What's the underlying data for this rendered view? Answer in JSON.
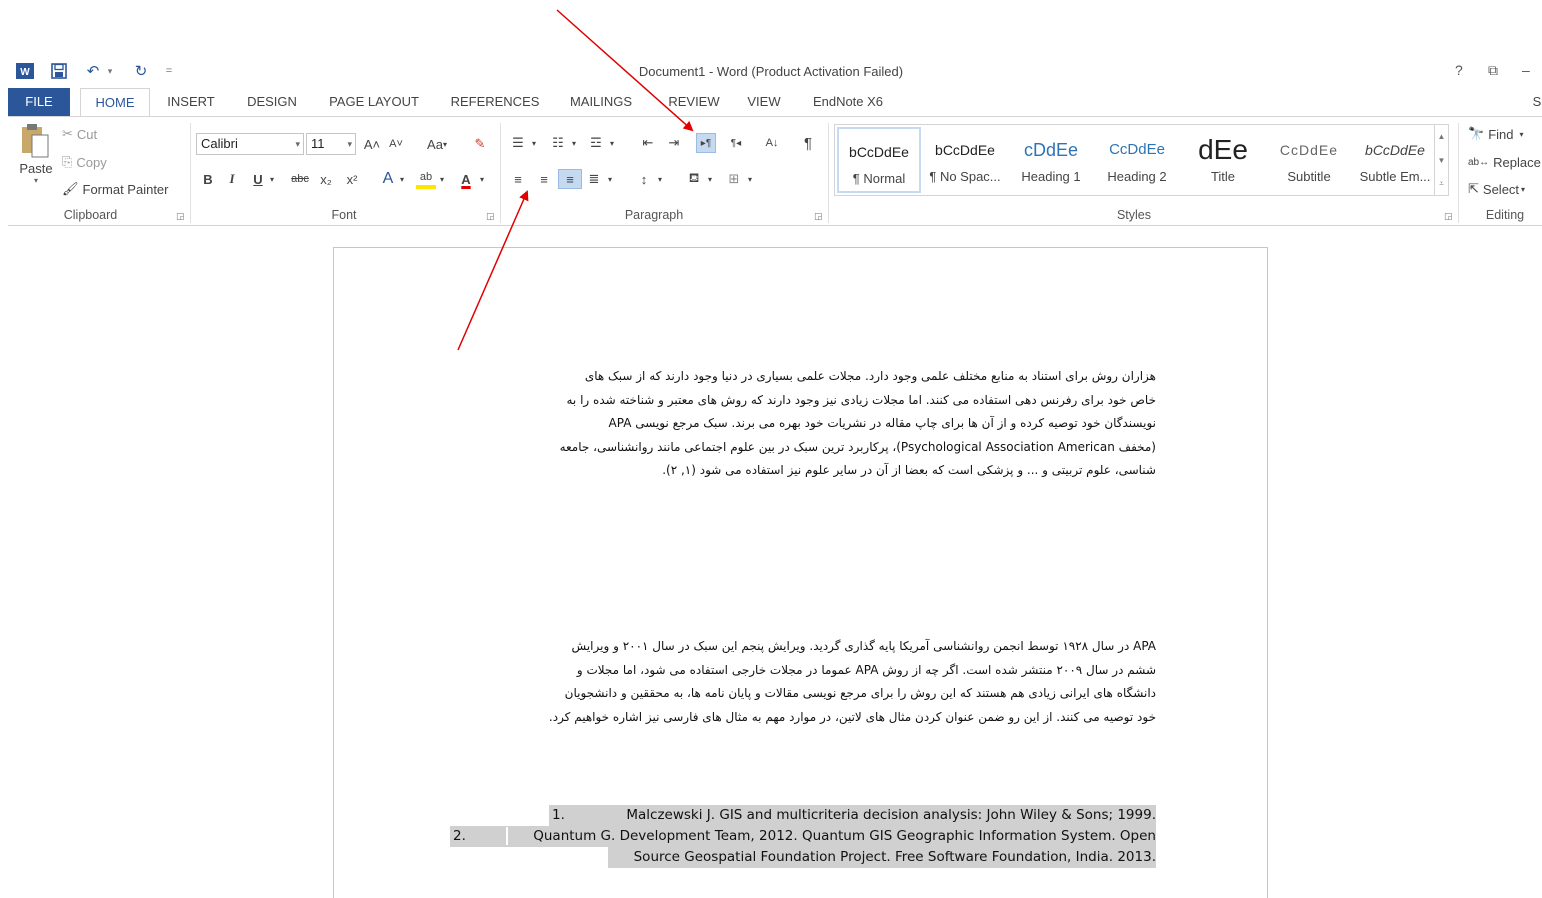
{
  "window": {
    "title": "Document1 - Word (Product Activation Failed)",
    "help_label": "?",
    "restore_label": "⧉",
    "minimize_label": "–"
  },
  "quick_access": {
    "word_icon": "W",
    "save_icon": "save-icon",
    "undo_glyph": "↶",
    "redo_glyph": "↻",
    "customize_glyph": "="
  },
  "tabs": [
    "FILE",
    "HOME",
    "INSERT",
    "DESIGN",
    "PAGE LAYOUT",
    "REFERENCES",
    "MAILINGS",
    "REVIEW",
    "VIEW",
    "EndNote X6"
  ],
  "tabs_overflow": "S",
  "clipboard": {
    "paste_label": "Paste",
    "cut_label": "Cut",
    "copy_label": "Copy",
    "format_painter_label": "Format Painter",
    "group_label": "Clipboard"
  },
  "font": {
    "font_name": "Calibri",
    "font_size": "11",
    "grow": "A˄",
    "shrink": "A˅",
    "case": "Aa",
    "bold": "B",
    "italic": "I",
    "underline": "U",
    "strike": "abc",
    "subscript": "x₂",
    "superscript": "x²",
    "text_effects": "A",
    "highlight": "ab",
    "font_color": "A",
    "group_label": "Font"
  },
  "paragraph": {
    "group_label": "Paragraph",
    "ltr_glyph": "▸¶",
    "rtl_glyph": "¶◂",
    "sort_glyph": "A↓",
    "show_marks_glyph": "¶"
  },
  "styles": {
    "group_label": "Styles",
    "items": [
      {
        "sample": "bCcDdEe",
        "name": "¶ Normal"
      },
      {
        "sample": "bCcDdEe",
        "name": "¶ No Spac..."
      },
      {
        "sample": "cDdEe",
        "name": "Heading 1"
      },
      {
        "sample": "CcDdEe",
        "name": "Heading 2"
      },
      {
        "sample": "dEe",
        "name": "Title"
      },
      {
        "sample": "CcDdEe",
        "name": "Subtitle"
      },
      {
        "sample": "bCcDdEe",
        "name": "Subtle Em..."
      }
    ]
  },
  "editing": {
    "group_label": "Editing",
    "find_label": "Find",
    "replace_label": "Replace",
    "select_label": "Select"
  },
  "document": {
    "paragraph1": [
      "هزاران روش برای استناد به منابع مختلف علمی وجود دارد. مجلات علمی بسیاری در دنیا وجود دارند که از سبک های",
      "خاص خود برای رفرنس دهی استفاده می کنند. اما مجلات زیادی نیز وجود دارند که روش های معتبر و شناخته شده را به",
      "نویسندگان خود توصیه کرده و از آن ها برای چاپ مقاله در نشریات خود بهره می برند. سبک مرجع نویسی APA",
      "(مخفف Psychological Association American)، پرکاربرد ترین سبک در بین علوم اجتماعی مانند روانشناسی، جامعه",
      "شناسی، علوم تربیتی و ... و پزشکی است که  بعضا از آن در سایر علوم نیز استفاده می شود (۱, ۲)."
    ],
    "paragraph2": [
      "APA در سال ۱۹۲۸ توسط انجمن روانشناسی آمریکا پایه گذاری گردید. ویرایش پنجم این سبک در سال ۲۰۰۱ و ویرایش",
      "ششم  در سال ۲۰۰۹ منتشر شده است. اگر چه از روش APA عموما در مجلات خارجی استفاده می شود، اما مجلات و",
      "دانشگاه های ایرانی زیادی هم هستند که این روش را برای مرجع نویسی مقالات و پایان نامه ها، به محققین و دانشجویان",
      "خود توصیه می کنند. از این رو ضمن عنوان کردن مثال های لاتین، در موارد مهم به مثال های فارسی نیز اشاره خواهیم کرد."
    ],
    "references": [
      {
        "num": "1.",
        "text": "Malczewski J. GIS and multicriteria decision analysis: John Wiley & Sons; 1999."
      },
      {
        "num": "2.",
        "text": "Quantum G. Development Team, 2012. Quantum GIS Geographic Information System. Open",
        "cont": "Source Geospatial Foundation Project. Free Software Foundation, India. 2013."
      }
    ]
  },
  "colors": {
    "accent": "#2b579a",
    "arrow": "#e00000",
    "highlight": "#d0d0d0",
    "selected_button": "#c5d9f1"
  }
}
